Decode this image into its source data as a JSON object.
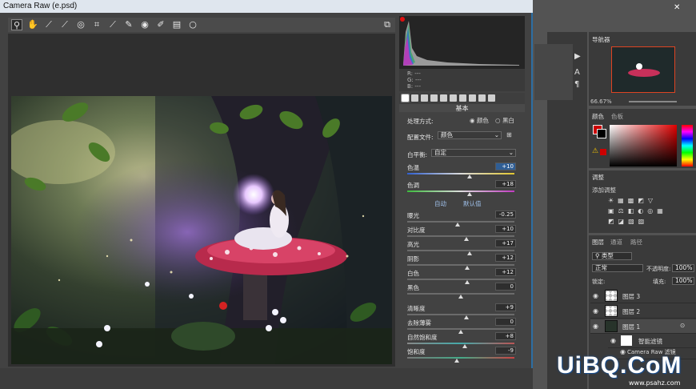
{
  "window": {
    "title": "Camera Raw (e.psd)"
  },
  "toolbar": {
    "tools": [
      "zoom-icon",
      "hand-icon",
      "white-balance-icon",
      "color-sampler-icon",
      "target-adjust-icon",
      "crop-icon",
      "straighten-icon",
      "spot-removal-icon",
      "red-eye-icon",
      "adjustment-brush-icon",
      "graduated-filter-icon",
      "radial-filter-icon"
    ],
    "open_preferences": "⧉"
  },
  "readout": {
    "r": "R:",
    "g": "G:",
    "b": "B:",
    "r_val": "---",
    "g_val": "---",
    "b_val": "---"
  },
  "panel": {
    "title": "基本",
    "treatment_label": "处理方式:",
    "treatment_color": "颜色",
    "treatment_bw": "黑白",
    "profile_label": "配置文件:",
    "profile_value": "颜色",
    "wb_label": "白平衡:",
    "wb_value": "自定",
    "auto": "自动",
    "default": "默认值",
    "sliders": [
      {
        "label": "色温",
        "value": "+10",
        "pos": 0.58
      },
      {
        "label": "色调",
        "value": "+18",
        "pos": 0.58
      },
      {
        "label": "曝光",
        "value": "-0.25",
        "pos": 0.47
      },
      {
        "label": "对比度",
        "value": "+10",
        "pos": 0.55
      },
      {
        "label": "高光",
        "value": "+17",
        "pos": 0.58
      },
      {
        "label": "阴影",
        "value": "+12",
        "pos": 0.56
      },
      {
        "label": "白色",
        "value": "+12",
        "pos": 0.56
      },
      {
        "label": "黑色",
        "value": "0",
        "pos": 0.5
      },
      {
        "label": "清晰度",
        "value": "+9",
        "pos": 0.55
      },
      {
        "label": "去除薄雾",
        "value": "0",
        "pos": 0.5
      },
      {
        "label": "自然饱和度",
        "value": "+8",
        "pos": 0.54
      },
      {
        "label": "饱和度",
        "value": "-9",
        "pos": 0.46
      }
    ]
  },
  "ps": {
    "navigator_tab": "导航器",
    "zoom_level": "66.67%",
    "color_tab": "颜色",
    "swatches_tab": "色板",
    "adjust_tab": "调整",
    "add_adjust": "添加调整",
    "layers_tab": "图层",
    "channels_tab": "通道",
    "paths_tab": "路径",
    "kind_filter": "类型",
    "blend_mode": "正常",
    "opacity_label": "不透明度:",
    "opacity": "100%",
    "lock_label": "锁定:",
    "fill_label": "填充:",
    "fill": "100%",
    "layers": [
      "图层 3",
      "图层 2",
      "图层 1"
    ],
    "smart_filters": "智能滤镜",
    "cr_filter": "Camera Raw 滤镜"
  },
  "watermark": {
    "text": "UiBQ.CoM",
    "sub": "www.psahz.com"
  },
  "colors": {
    "foreground": "#cc0000",
    "accent": "#2d6ea3"
  }
}
